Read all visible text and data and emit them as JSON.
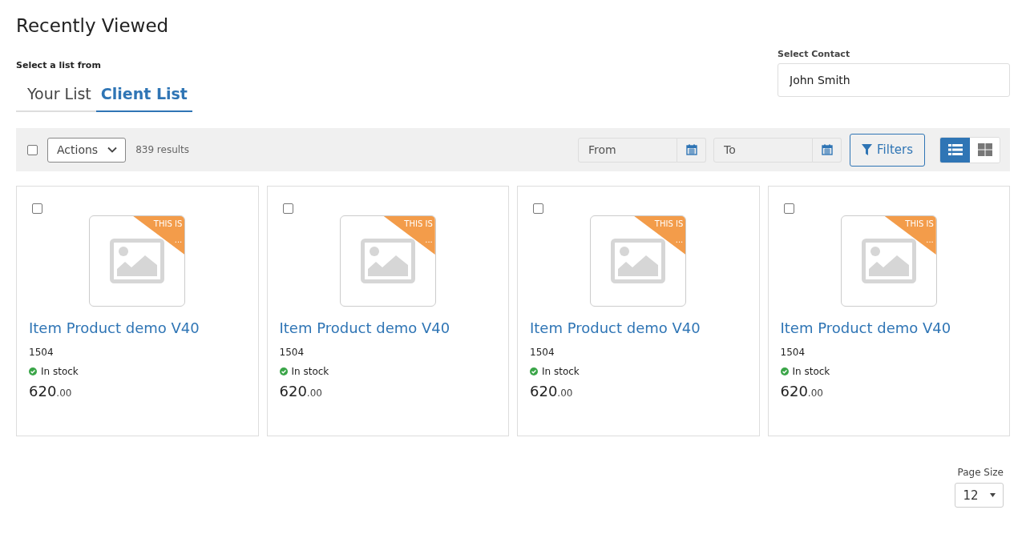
{
  "title": "Recently Viewed",
  "list_selector": {
    "label": "Select a list from",
    "tabs": [
      {
        "label": "Your List",
        "selected": false
      },
      {
        "label": "Client List",
        "selected": true
      }
    ]
  },
  "contact": {
    "label": "Select Contact",
    "value": "John Smith"
  },
  "toolbar": {
    "select_all_checked": false,
    "actions": "Actions",
    "results": "839 results",
    "from": {
      "placeholder": "From"
    },
    "to": {
      "placeholder": "To"
    },
    "filters": "Filters",
    "views": [
      {
        "kind": "list",
        "selected": true
      },
      {
        "kind": "grid",
        "selected": false
      }
    ]
  },
  "products": [
    {
      "checked": false,
      "ribbon": [
        "THIS IS",
        "..."
      ],
      "name": "Item Product demo V40",
      "code": "1504",
      "stock": "In stock",
      "price_whole": "620",
      "price_cents": ".00"
    },
    {
      "checked": false,
      "ribbon": [
        "THIS IS",
        "..."
      ],
      "name": "Item Product demo V40",
      "code": "1504",
      "stock": "In stock",
      "price_whole": "620",
      "price_cents": ".00"
    },
    {
      "checked": false,
      "ribbon": [
        "THIS IS",
        "..."
      ],
      "name": "Item Product demo V40",
      "code": "1504",
      "stock": "In stock",
      "price_whole": "620",
      "price_cents": ".00"
    },
    {
      "checked": false,
      "ribbon": [
        "THIS IS",
        "..."
      ],
      "name": "Item Product demo V40",
      "code": "1504",
      "stock": "In stock",
      "price_whole": "620",
      "price_cents": ".00"
    }
  ],
  "page_size": {
    "label": "Page Size",
    "value": "12"
  }
}
